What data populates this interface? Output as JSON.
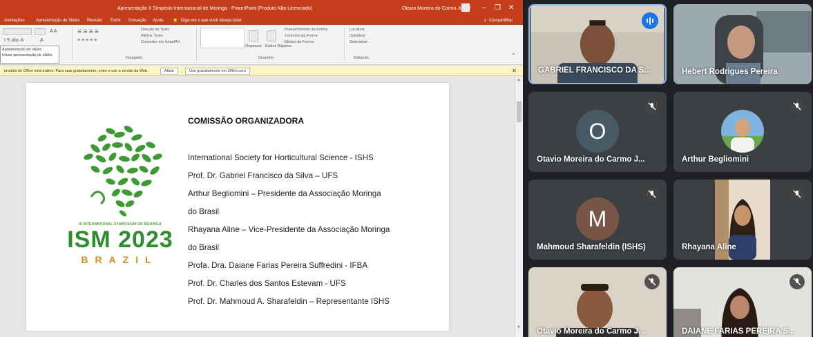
{
  "powerpoint": {
    "window_title": "Apresentação II Simpósio Internacional de Moringa - PowerPoint (Produto Não Licenciado)",
    "user_name": "Otavio Moreira do Carmo Junior",
    "search_hint": "Diga-me o que você deseja fazer",
    "share_label": "Compartilhar",
    "tabs": [
      "Animações",
      "Apresentação de Slides",
      "Revisão",
      "Exibir",
      "Gravação",
      "Ajuda"
    ],
    "ribbon": {
      "paragraph_group": "Parágrafo",
      "drawing_group": "Desenho",
      "editing_group": "Editando",
      "text_direction": "Direção do Texto",
      "align_text": "Alinhar Texto",
      "smartart": "Converter em SmartArt",
      "arrange": "Organizar",
      "quick_styles": "Estilos Rápidos",
      "shape_fill": "Preenchimento da Forma",
      "shape_outline": "Contorno da Forma",
      "shape_effects": "Efeitos da Forma",
      "find": "Localizar",
      "replace": "Substituir",
      "select": "Selecionar"
    },
    "slideshow_dropdown": [
      "Apresentação de slides",
      "Iniciar apresentação de slides"
    ],
    "info_bar": {
      "message": "produto do Office está inativo. Para usar gratuitamente, entre e use a versão da Web.",
      "activate": "Ativar",
      "use_free": "Use gratuitamente em Office.com"
    },
    "slide": {
      "logo_subtitle": "III INTERNATIONAL SYMPOSIUM ON MORINGA",
      "logo_title": "ISM 2023",
      "logo_country": "BRAZIL",
      "heading": "COMISSÃO ORGANIZADORA",
      "lines": [
        "International Society for Horticultural Science - ISHS",
        "Prof. Dr. Gabriel Francisco da Silva – UFS",
        "Arthur Begliomini – Presidente da Associação Moringa",
        "do Brasil",
        "Rhayana Aline – Vice-Presidente da Associação Moringa",
        "do Brasil",
        "Profa. Dra. Daiane Farias Pereira Suffredini - IFBA",
        "Prof. Dr. Charles dos Santos Estevam - UFS",
        "Prof. Dr. Mahmoud A. Sharafeldin – Representante ISHS"
      ]
    }
  },
  "meet": {
    "participants": [
      {
        "name": "GABRIEL FRANCISCO DA S...",
        "type": "video",
        "speaking": true
      },
      {
        "name": "Hebert Rodrigues Pereira",
        "type": "video",
        "muted": false
      },
      {
        "name": "Otavio Moreira do Carmo J...",
        "type": "avatar",
        "initial": "O",
        "avatar_color": "#455a64",
        "muted": true
      },
      {
        "name": "Arthur Begliomini",
        "type": "photo",
        "muted": true
      },
      {
        "name": "Mahmoud Sharafeldin (ISHS)",
        "type": "avatar",
        "initial": "M",
        "avatar_color": "#795548",
        "muted": true
      },
      {
        "name": "Rhayana Aline",
        "type": "video",
        "muted": true
      },
      {
        "name": "Otavio Moreira do Carmo J...",
        "type": "video",
        "muted": true
      },
      {
        "name": "DAIANE FARIAS PEREIRA S...",
        "type": "video",
        "muted": true
      }
    ]
  }
}
